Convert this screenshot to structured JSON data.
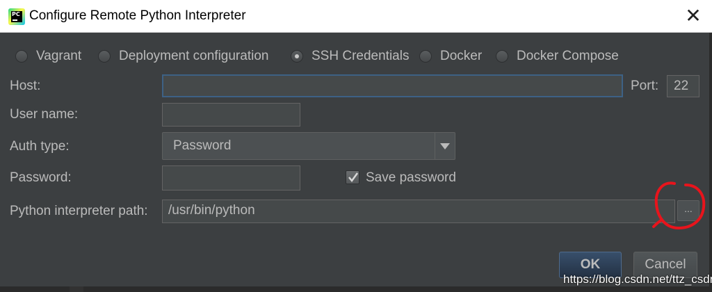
{
  "window": {
    "title": "Configure Remote Python Interpreter",
    "close_glyph": "✕",
    "app_icon_text": "PC"
  },
  "interpreter_types": [
    {
      "label": "Vagrant",
      "selected": false
    },
    {
      "label": "Deployment configuration",
      "selected": false
    },
    {
      "label": "SSH Credentials",
      "selected": true
    },
    {
      "label": "Docker",
      "selected": false
    },
    {
      "label": "Docker Compose",
      "selected": false
    }
  ],
  "form": {
    "host_label": "Host:",
    "host_value": "",
    "port_label": "Port:",
    "port_value": "22",
    "username_label": "User name:",
    "username_value": "",
    "auth_type_label": "Auth type:",
    "auth_type_value": "Password",
    "password_label": "Password:",
    "password_value": "",
    "save_password_label": "Save password",
    "save_password_checked": true,
    "interpreter_path_label": "Python interpreter path:",
    "interpreter_path_value": "/usr/bin/python",
    "browse_label": "..."
  },
  "buttons": {
    "ok": "OK",
    "cancel": "Cancel"
  },
  "watermark": "https://blog.csdn.net/ttz_csdn",
  "colors": {
    "dialog_bg": "#3c3f41",
    "field_bg": "#45494a",
    "text": "#bbbbbb",
    "focus_border": "#3d6185",
    "annotation": "#e8141c"
  }
}
